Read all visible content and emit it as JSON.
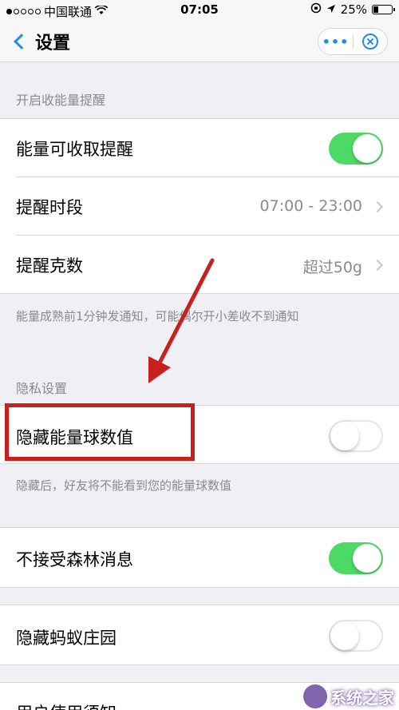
{
  "status_bar": {
    "carrier": "中国联通",
    "time": "07:05",
    "battery": "25%"
  },
  "nav": {
    "title": "设置",
    "more_label": "•••"
  },
  "sections": {
    "reminder_header": "开启收能量提醒",
    "privacy_header": "隐私设置"
  },
  "rows": {
    "energy_reminder": {
      "label": "能量可收取提醒",
      "toggle": true
    },
    "reminder_period": {
      "label": "提醒时段",
      "value": "07:00 - 23:00"
    },
    "reminder_grams": {
      "label": "提醒克数",
      "value": "超过50g"
    },
    "hide_energy_value": {
      "label": "隐藏能量球数值",
      "toggle": false
    },
    "reject_forest_msg": {
      "label": "不接受森林消息",
      "toggle": true
    },
    "hide_ant_farm": {
      "label": "隐藏蚂蚁庄园",
      "toggle": false
    },
    "user_notice": {
      "label": "用户使用须知"
    }
  },
  "notes": {
    "reminder_note": "能量成熟前1分钟发通知，可能偶尔开小差收不到通知",
    "privacy_note": "隐藏后，好友将不能看到您的能量球数值"
  },
  "watermark": {
    "text": "系统之家"
  },
  "colors": {
    "accent": "#1e8cf0",
    "toggle_on": "#4cd964",
    "highlight": "#c8201e"
  }
}
